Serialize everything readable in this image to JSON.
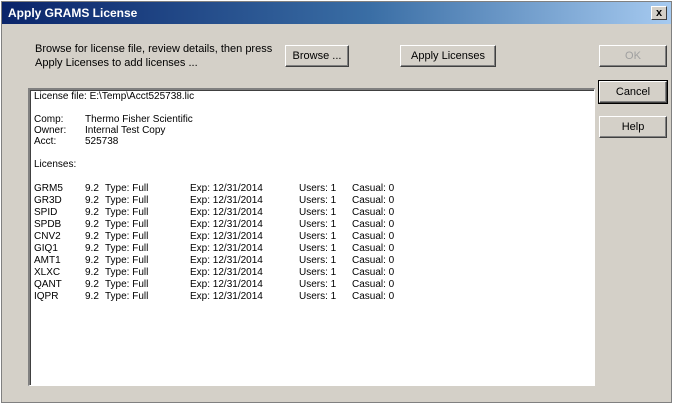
{
  "window": {
    "title": "Apply GRAMS License",
    "close_label": "x"
  },
  "instructions": "Browse for license file, review details, then press Apply Licenses to add licenses ...",
  "buttons": {
    "browse": "Browse ...",
    "apply": "Apply Licenses",
    "ok": "OK",
    "cancel": "Cancel",
    "help": "Help"
  },
  "license": {
    "file_line": "License file: E:\\Temp\\Acct525738.lic",
    "comp_label": "Comp:",
    "comp_value": "Thermo Fisher Scientific",
    "owner_label": "Owner:",
    "owner_value": "Internal Test Copy",
    "acct_label": "Acct:",
    "acct_value": "525738",
    "licenses_heading": "Licenses:",
    "rows": [
      {
        "code": "GRM5",
        "ver": "9.2",
        "type": "Type: Full",
        "exp": "Exp: 12/31/2014",
        "users": "Users: 1",
        "casual": "Casual: 0"
      },
      {
        "code": "GR3D",
        "ver": "9.2",
        "type": "Type: Full",
        "exp": "Exp: 12/31/2014",
        "users": "Users: 1",
        "casual": "Casual: 0"
      },
      {
        "code": "SPID",
        "ver": "9.2",
        "type": "Type: Full",
        "exp": "Exp: 12/31/2014",
        "users": "Users: 1",
        "casual": "Casual: 0"
      },
      {
        "code": "SPDB",
        "ver": "9.2",
        "type": "Type: Full",
        "exp": "Exp: 12/31/2014",
        "users": "Users: 1",
        "casual": "Casual: 0"
      },
      {
        "code": "CNV2",
        "ver": "9.2",
        "type": "Type: Full",
        "exp": "Exp: 12/31/2014",
        "users": "Users: 1",
        "casual": "Casual: 0"
      },
      {
        "code": "GIQ1",
        "ver": "9.2",
        "type": "Type: Full",
        "exp": "Exp: 12/31/2014",
        "users": "Users: 1",
        "casual": "Casual: 0"
      },
      {
        "code": "AMT1",
        "ver": "9.2",
        "type": "Type: Full",
        "exp": "Exp: 12/31/2014",
        "users": "Users: 1",
        "casual": "Casual: 0"
      },
      {
        "code": "XLXC",
        "ver": "9.2",
        "type": "Type: Full",
        "exp": "Exp: 12/31/2014",
        "users": "Users: 1",
        "casual": "Casual: 0"
      },
      {
        "code": "QANT",
        "ver": "9.2",
        "type": "Type: Full",
        "exp": "Exp: 12/31/2014",
        "users": "Users: 1",
        "casual": "Casual: 0"
      },
      {
        "code": "IQPR",
        "ver": "9.2",
        "type": "Type: Full",
        "exp": "Exp: 12/31/2014",
        "users": "Users: 1",
        "casual": "Casual: 0"
      }
    ]
  }
}
